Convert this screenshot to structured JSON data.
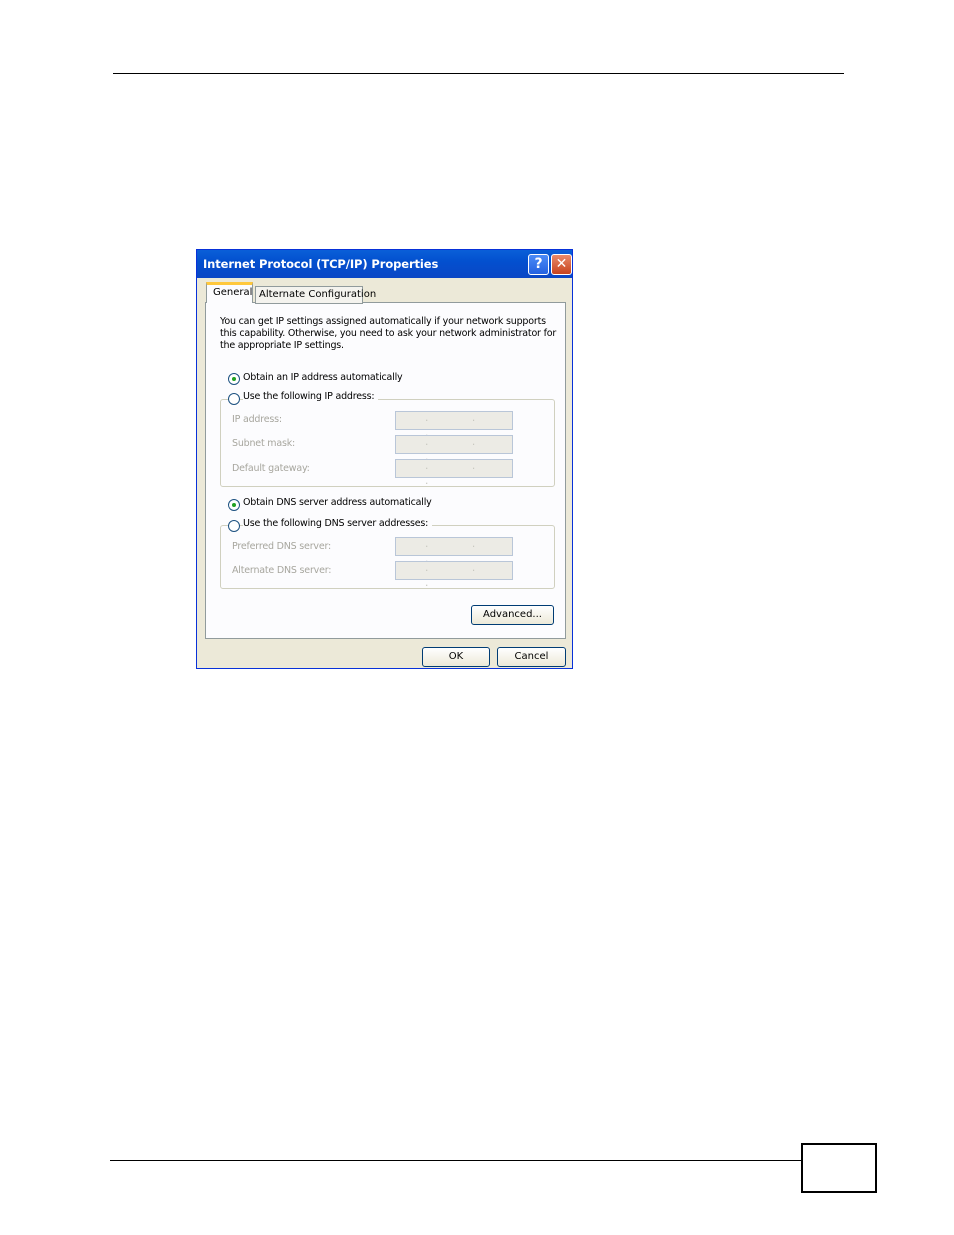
{
  "dialog": {
    "title": "Internet Protocol (TCP/IP) Properties",
    "help_label": "?",
    "close_label": "✕",
    "tabs": [
      {
        "label": "General",
        "selected": true
      },
      {
        "label": "Alternate Configuration",
        "selected": false
      }
    ],
    "description": "You can get IP settings assigned automatically if your network supports this capability. Otherwise, you need to ask your network administrator for the appropriate IP settings.",
    "ip": {
      "obtain_auto_label": "Obtain an IP address automatically",
      "use_following_label": "Use the following IP address:",
      "selected": "obtain_auto",
      "fields": [
        {
          "label": "IP address:",
          "value": ". . ."
        },
        {
          "label": "Subnet mask:",
          "value": ". . ."
        },
        {
          "label": "Default gateway:",
          "value": ". . ."
        }
      ]
    },
    "dns": {
      "obtain_auto_label": "Obtain DNS server address automatically",
      "use_following_label": "Use the following DNS server addresses:",
      "selected": "obtain_auto",
      "fields": [
        {
          "label": "Preferred DNS server:",
          "value": ". . ."
        },
        {
          "label": "Alternate DNS server:",
          "value": ". . ."
        }
      ]
    },
    "advanced_label": "Advanced...",
    "ok_label": "OK",
    "cancel_label": "Cancel"
  }
}
